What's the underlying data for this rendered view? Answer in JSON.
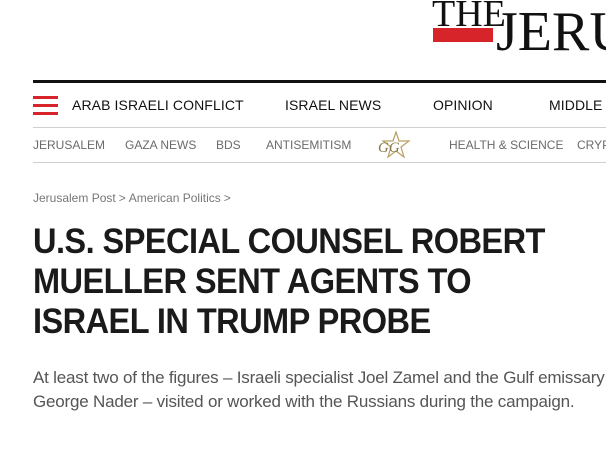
{
  "logo": {
    "text_small": "THE",
    "text_large": "JERU"
  },
  "main_nav": {
    "items": [
      {
        "label": "ARAB ISRAELI CONFLICT"
      },
      {
        "label": "ISRAEL NEWS"
      },
      {
        "label": "OPINION"
      },
      {
        "label": "MIDDLE E"
      }
    ]
  },
  "secondary_nav": {
    "items": [
      {
        "label": "JERUSALEM"
      },
      {
        "label": "GAZA NEWS"
      },
      {
        "label": "BDS"
      },
      {
        "label": "ANTISEMITISM"
      },
      {
        "label": "HEALTH & SCIENCE"
      },
      {
        "label": "CRYP"
      }
    ],
    "logo_text": "GG"
  },
  "breadcrumb": {
    "items": [
      {
        "label": "Jerusalem Post"
      },
      {
        "label": "American Politics"
      }
    ],
    "separator": ">"
  },
  "article": {
    "headline": "U.S. SPECIAL COUNSEL ROBERT MUELLER SENT AGENTS TO ISRAEL IN TRUMP PROBE",
    "subtitle": "At least two of the figures – Israeli specialist Joel Zamel and the Gulf emissary George Nader – visited or worked with the Russians during the campaign."
  },
  "colors": {
    "brand_red": "#d6242a",
    "text_dark": "#1a1a1a",
    "text_gray": "#555555"
  }
}
